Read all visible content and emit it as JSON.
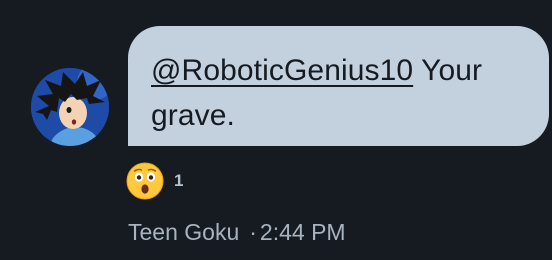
{
  "message": {
    "mention": "@RoboticGenius10",
    "text": " Your grave."
  },
  "reaction": {
    "emoji": "astonished-face-icon",
    "count": "1"
  },
  "meta": {
    "author": "Teen Goku",
    "separator": "·",
    "time": "2:44 PM"
  },
  "colors": {
    "background": "#161b22",
    "bubble": "#c3d1de",
    "meta_text": "#a7b3bf",
    "avatar_bg": "#1f4fb0"
  }
}
